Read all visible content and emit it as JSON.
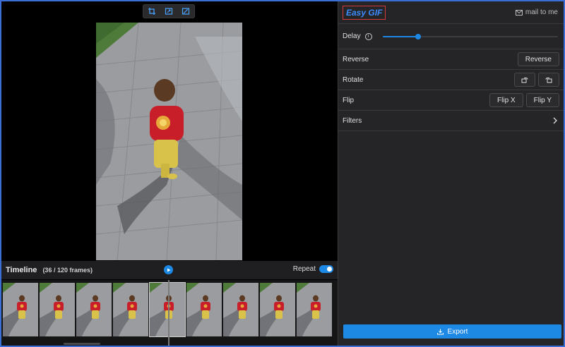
{
  "toolbar": {
    "icons": [
      "crop-icon",
      "resize-icon",
      "transform-icon"
    ]
  },
  "timeline": {
    "title": "Timeline",
    "frame_count": "(36 / 120 frames)",
    "repeat_label": "Repeat",
    "repeat_on": true,
    "frames_visible": 9,
    "selected_frame_index": 4
  },
  "header": {
    "logo": "Easy GIF",
    "mail": "mail to me"
  },
  "settings": {
    "delay": {
      "label": "Delay",
      "value_fraction": 0.2
    },
    "reverse": {
      "label": "Reverse",
      "button": "Reverse"
    },
    "rotate": {
      "label": "Rotate"
    },
    "flip": {
      "label": "Flip",
      "flip_x": "Flip X",
      "flip_y": "Flip Y"
    },
    "filters": {
      "label": "Filters"
    }
  },
  "export": {
    "label": "Export"
  },
  "colors": {
    "accent": "#1e88e5",
    "panel": "#252527",
    "logo_border": "#d23b3b"
  }
}
